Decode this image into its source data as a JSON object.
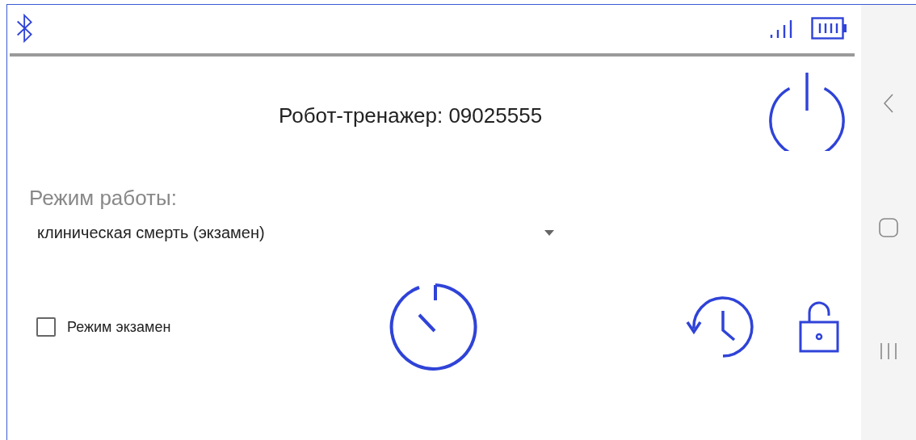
{
  "device": {
    "title": "Робот-тренажер: 09025555"
  },
  "mode": {
    "label": "Режим работы:",
    "value": "клиническая смерть (экзамен)"
  },
  "exam_mode": {
    "label": "Режим экзамен",
    "checked": false
  }
}
